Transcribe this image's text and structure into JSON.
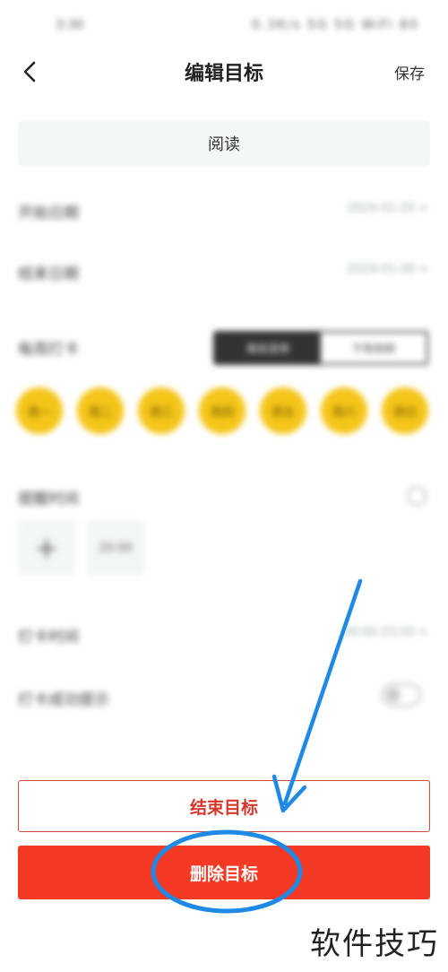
{
  "status_bar": {
    "time": "3:30",
    "icons": "0.3K/s 5G 5G WiFi 80"
  },
  "nav": {
    "title": "编辑目标",
    "save_label": "保存",
    "back_icon": "chevron-left-icon"
  },
  "goal": {
    "name": "阅读"
  },
  "fields": {
    "start_date": {
      "label": "开始日期",
      "value": "2024-01-20 >"
    },
    "end_date": {
      "label": "结束日期",
      "value": "2024-01-28 >"
    },
    "weekly": {
      "label": "每周打卡",
      "options": [
        "周目坚持",
        "不限周期"
      ],
      "selected": "周目坚持",
      "days": [
        "周一",
        "周二",
        "周三",
        "周四",
        "周五",
        "周六",
        "周日"
      ]
    },
    "remind": {
      "label": "提醒时间",
      "add_label": "+",
      "time": "20:00"
    },
    "interval": {
      "label": "打卡时间",
      "value": "00:00-23:59 >"
    },
    "prompt": {
      "label": "打卡成功提示"
    }
  },
  "actions": {
    "end_label": "结束目标",
    "delete_label": "删除目标"
  },
  "watermark": "软件技巧",
  "colors": {
    "accent_red": "#f43a24",
    "outline_red": "#d64a3d",
    "day_yellow": "#f5c518",
    "annotation_blue": "#1f8ae6"
  }
}
